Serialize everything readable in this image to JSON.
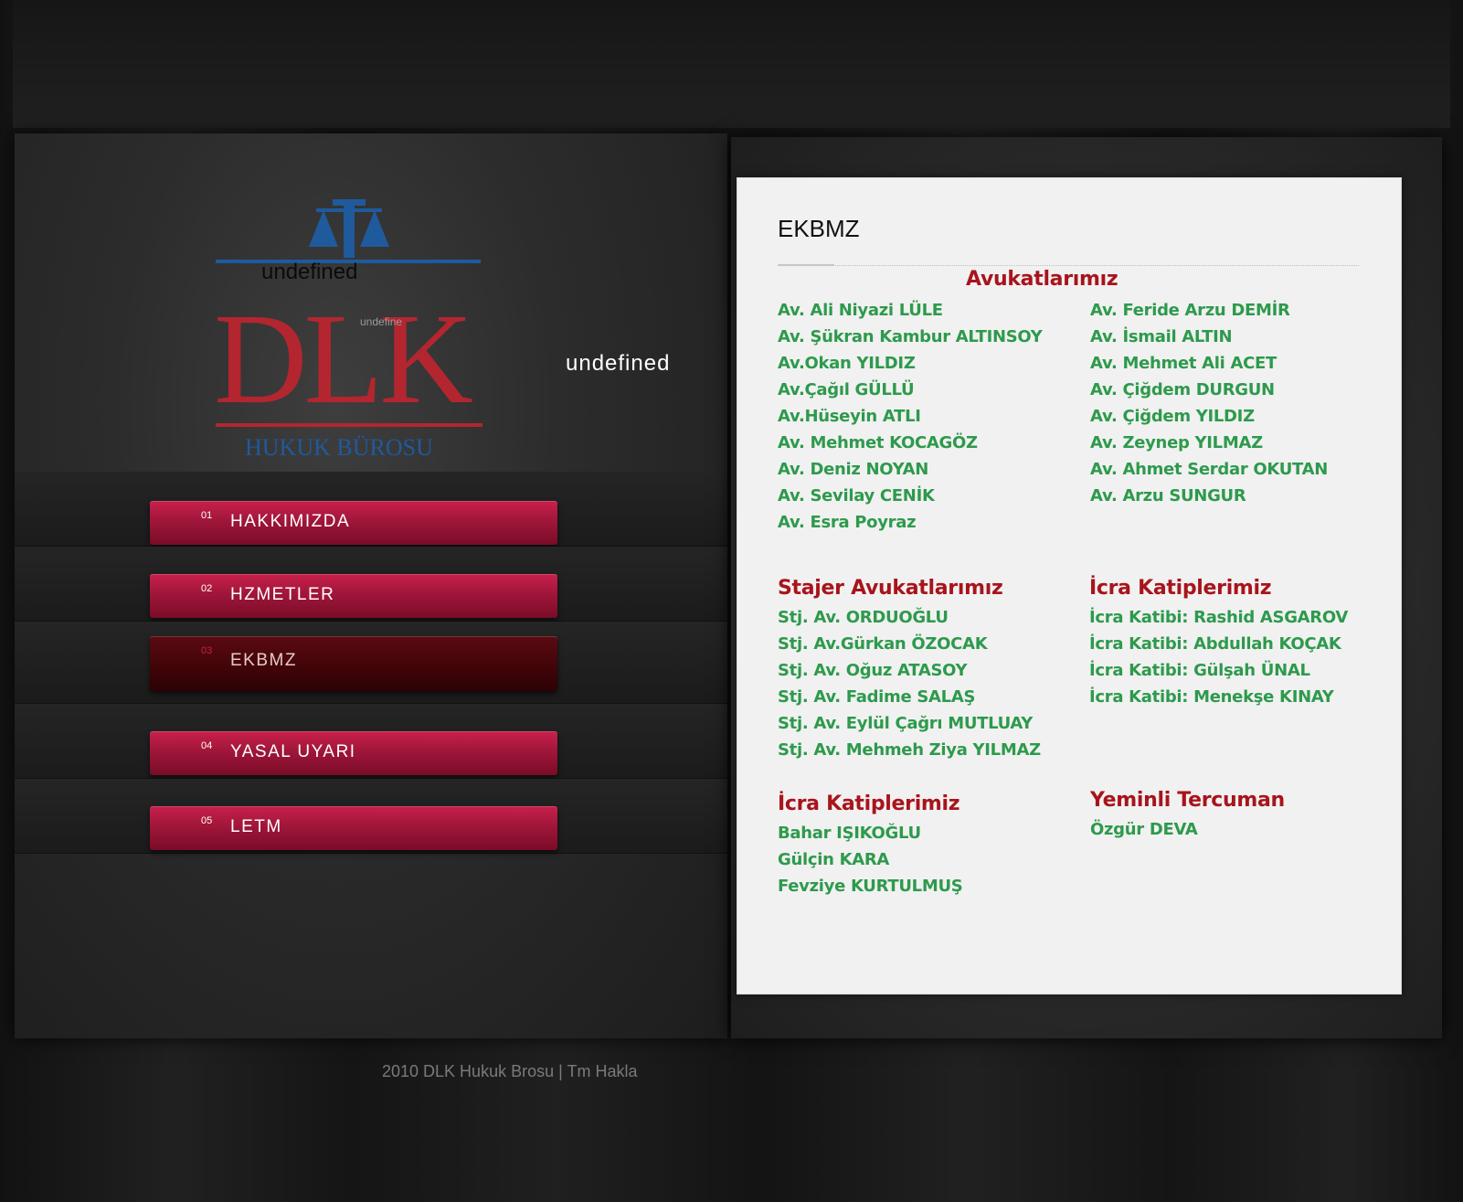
{
  "logo": {
    "brand": "DLK",
    "subtitle": "HUKUK BÜROSU",
    "overlay_text_1": "undefined",
    "overlay_text_2": "undefine",
    "colors": {
      "brand_red": "#b3262f",
      "brand_blue": "#1f5a9c"
    }
  },
  "side_text": "undefined",
  "menu": [
    {
      "num": "01",
      "label": "HAKKIMIZDA",
      "active": false
    },
    {
      "num": "02",
      "label": "HZMETLER",
      "active": false
    },
    {
      "num": "03",
      "label": "EKBMZ",
      "active": true
    },
    {
      "num": "04",
      "label": "YASAL UYARI",
      "active": false
    },
    {
      "num": "05",
      "label": "LETM",
      "active": false
    }
  ],
  "footer": "2010 DLK Hukuk Brosu  |  Tm Hakla",
  "content": {
    "title": "EKBMZ",
    "avukatlar": {
      "heading": "Avukatlarımız",
      "left": [
        "Av. Ali Niyazi LÜLE",
        "Av. Şükran Kambur ALTINSOY",
        "Av.Okan YILDIZ",
        "Av.Çağıl GÜLLÜ",
        "Av.Hüseyin ATLI",
        "Av. Mehmet KOCAGÖZ",
        "Av. Deniz NOYAN",
        "Av. Sevilay CENİK",
        "Av. Esra Poyraz"
      ],
      "right": [
        "Av. Feride Arzu DEMİR",
        "Av. İsmail ALTIN",
        "Av. Mehmet Ali ACET",
        "Av. Çiğdem DURGUN",
        "Av. Çiğdem YILDIZ",
        "Av. Zeynep YILMAZ",
        "Av. Ahmet Serdar OKUTAN",
        "Av. Arzu SUNGUR"
      ]
    },
    "stajer": {
      "heading": "Stajer Avukatlarımız",
      "items": [
        "Stj. Av. ORDUOĞLU",
        "Stj. Av.Gürkan ÖZOCAK",
        "Stj. Av. Oğuz ATASOY",
        "Stj. Av. Fadime SALAŞ",
        "Stj. Av. Eylül Çağrı MUTLUAY",
        "Stj. Av. Mehmeh Ziya YILMAZ"
      ]
    },
    "icra1": {
      "heading": "İcra Katiplerimiz",
      "items": [
        "İcra Katibi: Rashid ASGAROV",
        "İcra Katibi: Abdullah KOÇAK",
        "İcra Katibi: Gülşah ÜNAL",
        "İcra Katibi: Menekşe KINAY"
      ]
    },
    "icra2": {
      "heading": "İcra Katiplerimiz",
      "items": [
        "Bahar IŞIKOĞLU",
        "Gülçin KARA",
        "Fevziye KURTULMUŞ"
      ]
    },
    "yeminli": {
      "heading": "Yeminli Tercuman",
      "items": [
        "Özgür DEVA"
      ]
    },
    "colors": {
      "heading": "#a8141c",
      "name": "#2d9a4c"
    }
  }
}
